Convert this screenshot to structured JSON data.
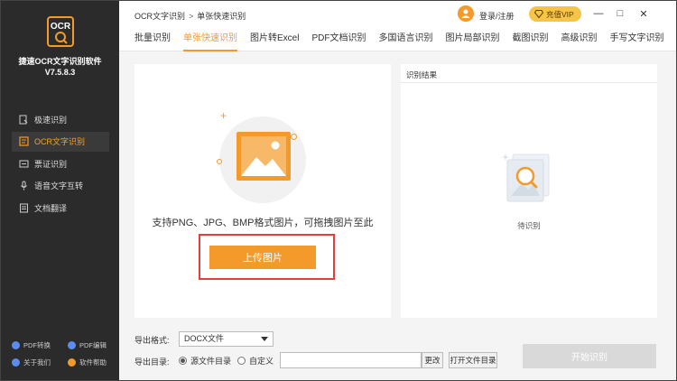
{
  "app": {
    "logo_text": "OCR",
    "name": "捷速OCR文字识别软件",
    "version": "V7.5.8.3"
  },
  "sidebar": {
    "items": [
      {
        "label": "极速识别",
        "icon": "flash-scan-icon",
        "active": false
      },
      {
        "label": "OCR文字识别",
        "icon": "ocr-text-icon",
        "active": true
      },
      {
        "label": "票证识别",
        "icon": "ticket-icon",
        "active": false
      },
      {
        "label": "语音文字互转",
        "icon": "microphone-icon",
        "active": false
      },
      {
        "label": "文档翻译",
        "icon": "document-translate-icon",
        "active": false
      }
    ],
    "bottom_links": [
      {
        "label": "PDF转换",
        "color": "#5b8def"
      },
      {
        "label": "PDF编辑",
        "color": "#5b8def"
      },
      {
        "label": "关于我们",
        "color": "#5b8def"
      },
      {
        "label": "软件帮助",
        "color": "#f39a2b"
      }
    ]
  },
  "header": {
    "breadcrumb_root": "OCR文字识别",
    "breadcrumb_sep": ">",
    "breadcrumb_current": "单张快速识别",
    "login_label": "登录/注册",
    "vip_label": "充值VIP",
    "minimize": "—",
    "maximize": "□",
    "close": "✕"
  },
  "tabs": [
    {
      "label": "批量识别",
      "active": false
    },
    {
      "label": "单张快速识别",
      "active": true
    },
    {
      "label": "图片转Excel",
      "active": false
    },
    {
      "label": "PDF文档识别",
      "active": false
    },
    {
      "label": "多国语言识别",
      "active": false
    },
    {
      "label": "图片局部识别",
      "active": false
    },
    {
      "label": "截图识别",
      "active": false
    },
    {
      "label": "高级识别",
      "active": false
    },
    {
      "label": "手写文字识别",
      "active": false
    }
  ],
  "upload": {
    "hint": "支持PNG、JPG、BMP格式图片，可拖拽图片至此",
    "button_label": "上传图片"
  },
  "result": {
    "title": "识别结果",
    "status": "待识别"
  },
  "export": {
    "format_label": "导出格式:",
    "format_value": "DOCX文件",
    "dir_label": "导出目录:",
    "radio_source": "源文件目录",
    "radio_custom": "自定义",
    "path_value": "",
    "change_label": "更改",
    "open_dir_label": "打开文件目录",
    "start_label": "开始识别"
  },
  "colors": {
    "accent": "#f39a2b",
    "sidebar_bg": "#2b2b2b",
    "highlight_box": "#e53e3e",
    "vip_gold": "#f6c548"
  }
}
